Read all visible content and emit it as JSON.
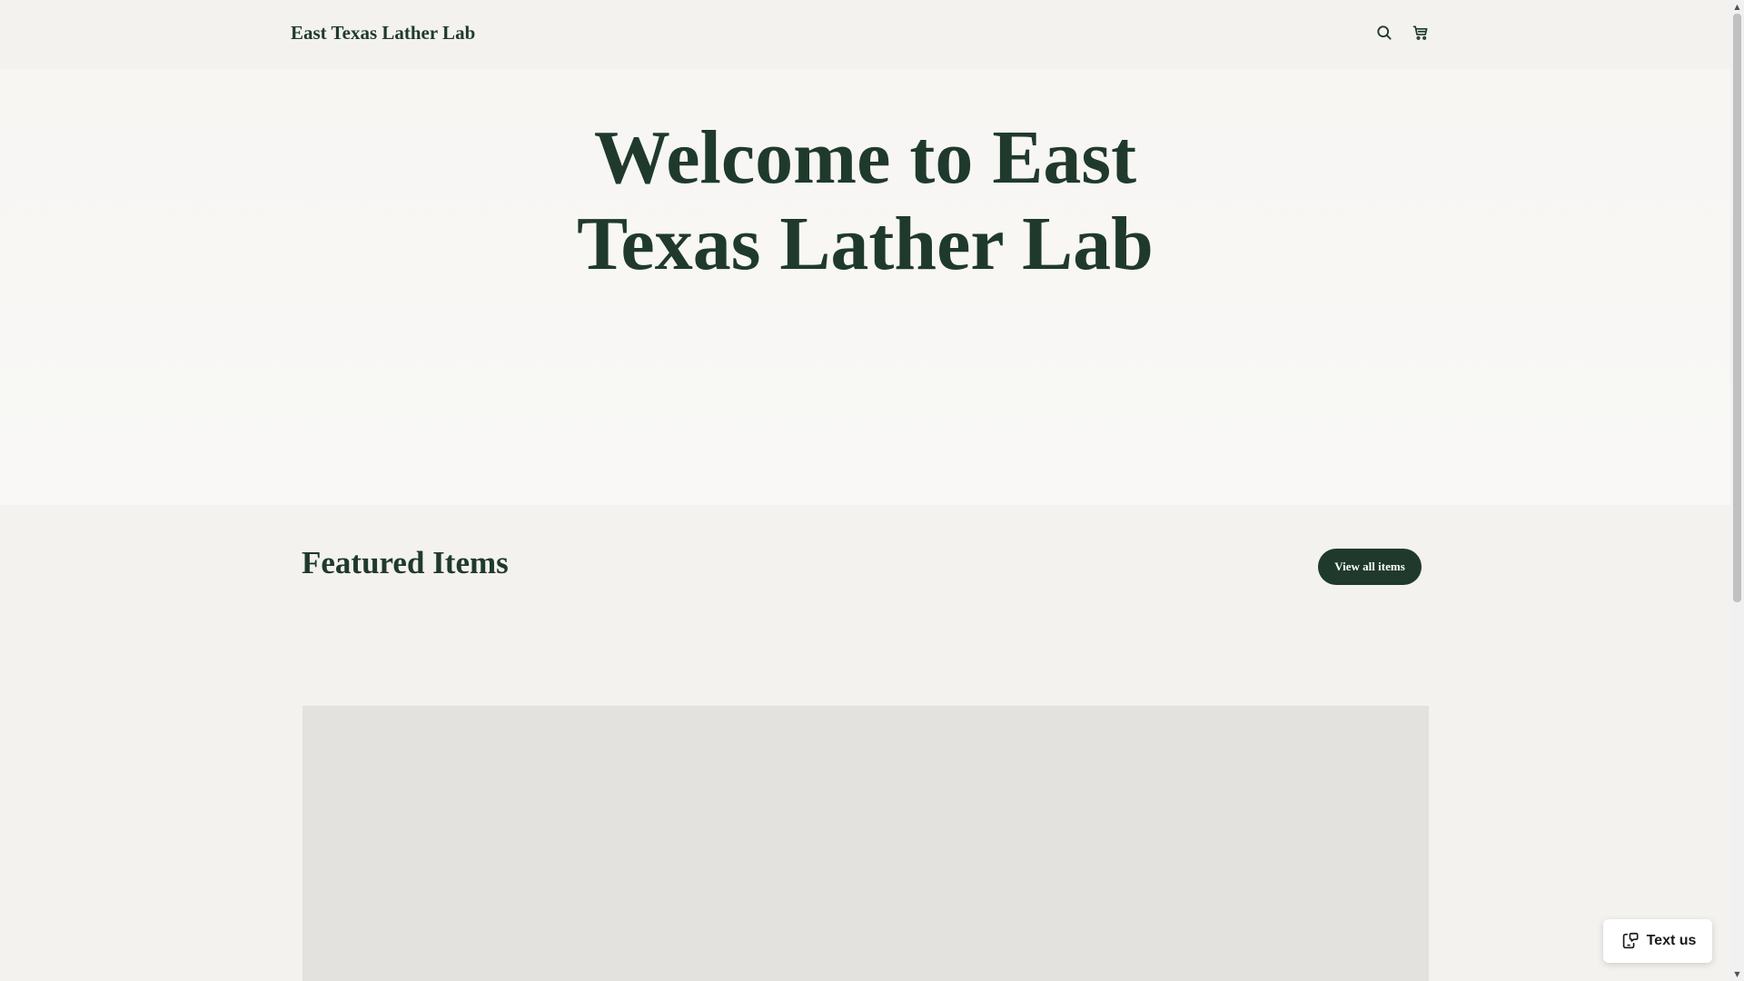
{
  "header": {
    "brand": "East Texas Lather Lab",
    "icons": [
      "search-icon",
      "cart-icon"
    ]
  },
  "hero": {
    "title": "Welcome to East Texas Lather Lab"
  },
  "featured": {
    "title": "Featured Items",
    "view_all_label": "View all items"
  },
  "widget": {
    "text_us_label": "Text us",
    "icon": "chat-phone-icon"
  },
  "colors": {
    "brand_green": "#1f3a2c",
    "background": "#f4f2ee",
    "placeholder": "#e4e2de"
  }
}
